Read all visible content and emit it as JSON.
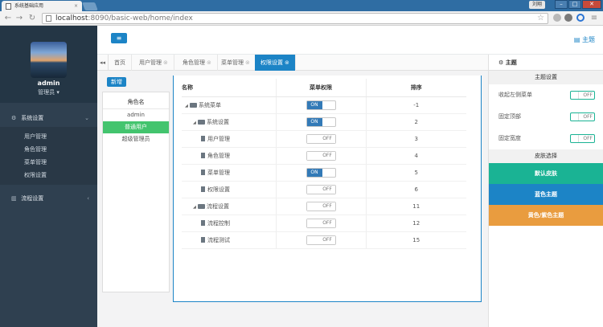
{
  "browser": {
    "tab_title": "系统基础应用",
    "tab_close": "×",
    "url_prefix": "localhost",
    "url_rest": ":8090/basic-web/home/index",
    "user_chip": "刘翔",
    "win_min": "–",
    "win_max": "□",
    "win_close": "✕"
  },
  "sidebar": {
    "user_name": "admin",
    "user_role": "管理员 ▾",
    "groups": [
      {
        "label": "系统设置",
        "icon": "gears-icon",
        "items": [
          "用户管理",
          "角色管理",
          "菜单管理",
          "权限设置"
        ]
      },
      {
        "label": "流程设置",
        "icon": "bar-chart-icon",
        "items": []
      }
    ]
  },
  "topbar": {
    "menu_toggle": "≡",
    "theme_label": "主题"
  },
  "tabs": [
    {
      "label": "首页",
      "closable": false,
      "active": false
    },
    {
      "label": "用户管理",
      "closable": true,
      "active": false
    },
    {
      "label": "角色管理",
      "closable": true,
      "active": false
    },
    {
      "label": "菜单管理",
      "closable": true,
      "active": false
    },
    {
      "label": "权限设置",
      "closable": true,
      "active": true
    }
  ],
  "roles": {
    "add_label": "新增",
    "header": "角色名",
    "items": [
      "admin",
      "普通用户",
      "超级管理员"
    ],
    "selected": "普通用户"
  },
  "permissions": {
    "columns": [
      "名称",
      "菜单权限",
      "排序"
    ],
    "rows": [
      {
        "name": "系统菜单",
        "level": 0,
        "type": "folder",
        "on": true,
        "sort": "-1"
      },
      {
        "name": "系统设置",
        "level": 1,
        "type": "folder",
        "on": true,
        "sort": "2"
      },
      {
        "name": "用户管理",
        "level": 2,
        "type": "file",
        "on": false,
        "sort": "3"
      },
      {
        "name": "角色管理",
        "level": 2,
        "type": "file",
        "on": false,
        "sort": "4"
      },
      {
        "name": "菜单管理",
        "level": 2,
        "type": "file",
        "on": true,
        "sort": "5"
      },
      {
        "name": "权限设置",
        "level": 2,
        "type": "file",
        "on": false,
        "sort": "6"
      },
      {
        "name": "流程设置",
        "level": 1,
        "type": "folder",
        "on": false,
        "sort": "11"
      },
      {
        "name": "流程控制",
        "level": 2,
        "type": "file",
        "on": false,
        "sort": "12"
      },
      {
        "name": "流程测试",
        "level": 2,
        "type": "file",
        "on": false,
        "sort": "15"
      }
    ],
    "on_label": "ON",
    "off_label": "OFF"
  },
  "theme_panel": {
    "header": "主题",
    "layout_title": "主题设置",
    "settings": [
      {
        "label": "收起左侧菜单",
        "state": "OFF"
      },
      {
        "label": "固定顶部",
        "state": "OFF"
      },
      {
        "label": "固定宽度",
        "state": "OFF"
      }
    ],
    "skin_title": "皮肤选择",
    "skins": [
      {
        "label": "默认皮肤",
        "color": "#1ab394"
      },
      {
        "label": "蓝色主题",
        "color": "#1c84c6"
      },
      {
        "label": "黄色/紫色主题",
        "color": "#e99c3f"
      }
    ]
  },
  "colors": {
    "accent": "#1c84c6",
    "sidebar": "#2f4050",
    "success": "#43c46e"
  }
}
